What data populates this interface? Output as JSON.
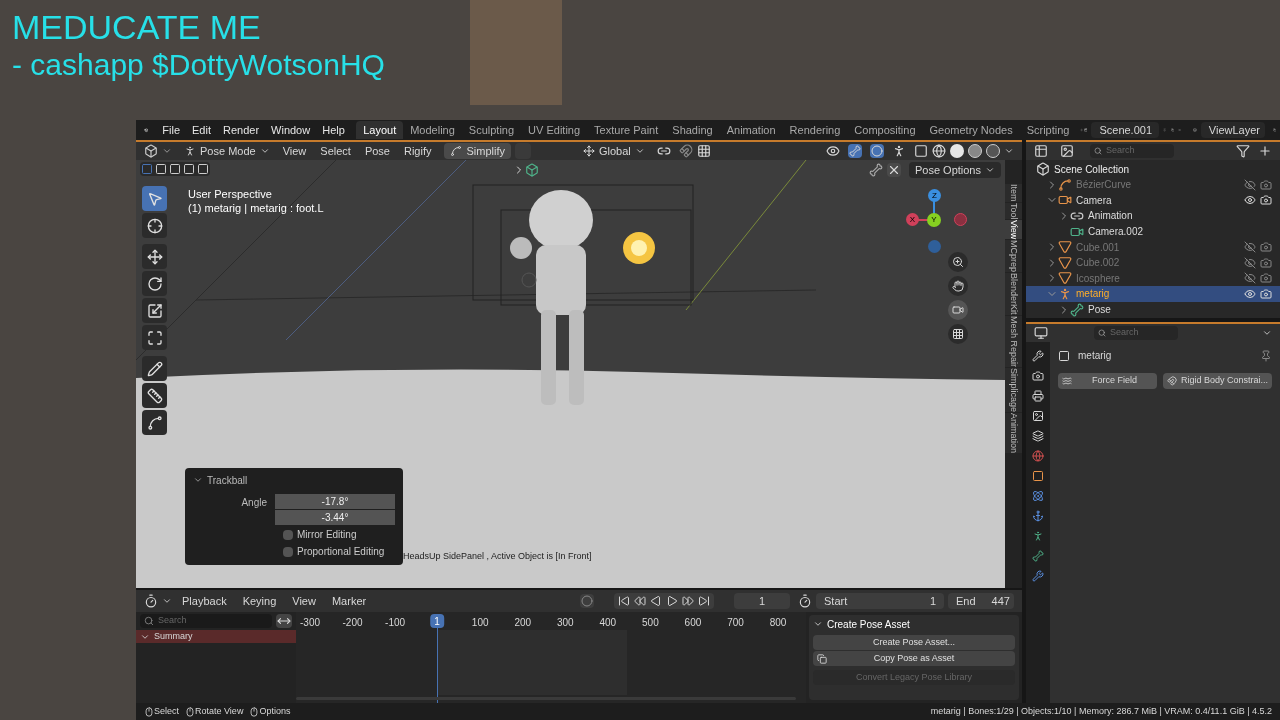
{
  "overlay": {
    "title": "MEDUCATE ME",
    "subtitle": "- cashapp $DottyWotsonHQ"
  },
  "menu": [
    "File",
    "Edit",
    "Render",
    "Window",
    "Help"
  ],
  "workspaces": [
    {
      "label": "Layout",
      "selected": true
    },
    {
      "label": "Modeling",
      "selected": false
    },
    {
      "label": "Sculpting",
      "selected": false
    },
    {
      "label": "UV Editing",
      "selected": false
    },
    {
      "label": "Texture Paint",
      "selected": false
    },
    {
      "label": "Shading",
      "selected": false
    },
    {
      "label": "Animation",
      "selected": false
    },
    {
      "label": "Rendering",
      "selected": false
    },
    {
      "label": "Compositing",
      "selected": false
    },
    {
      "label": "Geometry Nodes",
      "selected": false
    },
    {
      "label": "Scripting",
      "selected": false
    }
  ],
  "scene": "Scene.001",
  "view_layer": "ViewLayer",
  "viewport": {
    "mode": "Pose Mode",
    "menus": [
      "View",
      "Select",
      "Pose",
      "Rigify"
    ],
    "simplify": "Simplify",
    "orientation": "Global",
    "pose_options": "Pose Options",
    "view_name": "User Perspective",
    "active": "(1) metarig | metarig : foot.L",
    "gizmo": {
      "x": "X",
      "y": "Y",
      "z": "Z"
    },
    "tools": [
      {
        "kind": "select",
        "selected": true
      },
      {
        "kind": "cursor",
        "selected": false
      },
      {
        "kind": "move",
        "selected": false
      },
      {
        "kind": "rotate",
        "selected": false
      },
      {
        "kind": "scale",
        "selected": false
      },
      {
        "kind": "transform",
        "selected": false
      },
      {
        "kind": "annotate",
        "selected": false
      },
      {
        "kind": "measure",
        "selected": false
      },
      {
        "kind": "curve",
        "selected": false
      }
    ],
    "sidebar_tabs": [
      {
        "label": "Item",
        "selected": false
      },
      {
        "label": "Tool",
        "selected": false
      },
      {
        "label": "View",
        "selected": true
      },
      {
        "label": "MCprep",
        "selected": false
      },
      {
        "label": "BlenderKit",
        "selected": false
      },
      {
        "label": "Mesh Repair",
        "selected": false
      },
      {
        "label": "Simplicage",
        "selected": false
      },
      {
        "label": "Animation",
        "selected": false
      }
    ],
    "operator_panel": {
      "title": "Trackball",
      "label": "Angle",
      "values": [
        "-17.8°",
        "-3.44°"
      ],
      "options": [
        {
          "label": "Mirror Editing",
          "checked": false
        },
        {
          "label": "Proportional Editing",
          "checked": false
        }
      ]
    },
    "message": "HeadsUp SidePanel , Active Object is [In Front]"
  },
  "timeline": {
    "menus": [
      "Playback",
      "Keying",
      "View",
      "Marker"
    ],
    "current_frame": "1",
    "start_label": "Start",
    "start": "1",
    "end_label": "End",
    "end": "447",
    "search_placeholder": "Search",
    "channels": [
      {
        "label": "Summary",
        "selected": true
      }
    ],
    "ruler": [
      "-300",
      "-200",
      "-100",
      "100",
      "200",
      "300",
      "400",
      "500",
      "600",
      "700",
      "800"
    ],
    "marker": "1",
    "pose_panel": {
      "title": "Create Pose Asset",
      "buttons": [
        {
          "label": "Create Pose Asset...",
          "disabled": false,
          "kind": "plain"
        },
        {
          "label": "Copy Pose as Asset",
          "disabled": false,
          "kind": "icon"
        },
        {
          "label": "Convert Legacy Pose Library",
          "disabled": true,
          "kind": "plain"
        }
      ]
    }
  },
  "outliner": {
    "search_placeholder": "Search",
    "root": "Scene Collection",
    "items": [
      {
        "label": "BézierCurve",
        "kind": "curve",
        "expanded": false,
        "visible": false,
        "selected": false
      },
      {
        "label": "Camera",
        "kind": "camera",
        "expanded": true,
        "visible": true,
        "selected": false,
        "children": [
          {
            "label": "Animation",
            "kind": "animation",
            "expanded": false,
            "selected": false
          },
          {
            "label": "Camera.002",
            "kind": "camera-data",
            "selected": false
          }
        ]
      },
      {
        "label": "Cube.001",
        "kind": "mesh",
        "expanded": false,
        "visible": false,
        "selected": false
      },
      {
        "label": "Cube.002",
        "kind": "mesh",
        "expanded": false,
        "visible": false,
        "selected": false
      },
      {
        "label": "Icosphere",
        "kind": "mesh",
        "expanded": false,
        "visible": false,
        "selected": false
      },
      {
        "label": "metarig",
        "kind": "armature",
        "expanded": true,
        "visible": true,
        "selected": true,
        "children": [
          {
            "label": "Pose",
            "kind": "pose",
            "expanded": false,
            "selected": false
          }
        ]
      }
    ]
  },
  "properties": {
    "search_placeholder": "Search",
    "object": "metarig",
    "buttons": [
      "Force Field",
      "Rigid Body Constrai..."
    ]
  },
  "status_bar": {
    "hints": [
      "Select",
      "Rotate View",
      "Options"
    ],
    "info": "metarig | Bones:1/29 | Objects:1/10 | Memory: 286.7 MiB | VRAM: 0.4/11.1 GiB | 4.5.2"
  }
}
